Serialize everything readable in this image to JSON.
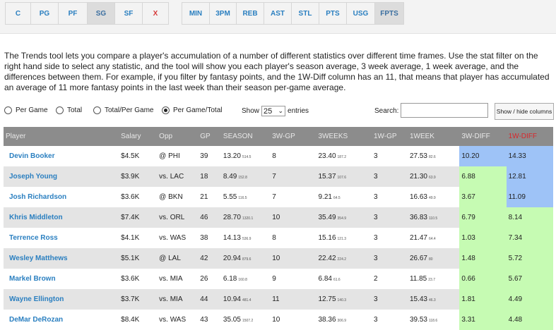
{
  "position_tabs": [
    {
      "label": "C",
      "active": false
    },
    {
      "label": "PG",
      "active": false
    },
    {
      "label": "PF",
      "active": false
    },
    {
      "label": "SG",
      "active": true
    },
    {
      "label": "SF",
      "active": false
    },
    {
      "label": "X",
      "active": false
    }
  ],
  "stat_tabs": [
    {
      "label": "MIN",
      "active": false
    },
    {
      "label": "3PM",
      "active": false
    },
    {
      "label": "REB",
      "active": false
    },
    {
      "label": "AST",
      "active": false
    },
    {
      "label": "STL",
      "active": false
    },
    {
      "label": "PTS",
      "active": false
    },
    {
      "label": "USG",
      "active": false
    },
    {
      "label": "FPTS",
      "active": true
    }
  ],
  "description": "The Trends tool lets you compare a player's accumulation of a number of different statistics over different time frames. Use the stat filter on the right hand side to select any statistic, and the tool will show you each player's season average, 3 week average, 1 week average, and the differences between them. For example, if you filter by fantasy points, and the 1W-Diff column has an 11, that means that player has accumulated an average of 11 more fantasy points in the last week than their season per-game average.",
  "radios": [
    {
      "label": "Per Game",
      "checked": false
    },
    {
      "label": "Total",
      "checked": false
    },
    {
      "label": "Total/Per Game",
      "checked": false
    },
    {
      "label": "Per Game/Total",
      "checked": true
    }
  ],
  "show": {
    "prefix": "Show",
    "value": "25",
    "suffix": "entries"
  },
  "search": {
    "label": "Search:",
    "value": ""
  },
  "toggle_button": "Show / hide columns",
  "colors": {
    "blue": "#9ec3f7",
    "green": "#c6fbb3",
    "header": "#8c8c8c"
  },
  "headers": [
    "Player",
    "Salary",
    "Opp",
    "GP",
    "SEASON",
    "3W-GP",
    "3WEEKS",
    "1W-GP",
    "1WEEK",
    "3W-DIFF",
    "1W-DIFF"
  ],
  "rows": [
    {
      "player": "Devin Booker",
      "salary": "$4.5K",
      "opp": "@ PHI",
      "gp": "39",
      "season": "13.20",
      "season_total": "514.5",
      "gp3": "8",
      "w3": "23.40",
      "w3_total": "187.2",
      "gp1": "3",
      "w1": "27.53",
      "w1_total": "82.6",
      "d3": "10.20",
      "d3_c": "blue",
      "d1": "14.33",
      "d1_c": "blue"
    },
    {
      "player": "Joseph Young",
      "salary": "$3.9K",
      "opp": "vs. LAC",
      "gp": "18",
      "season": "8.49",
      "season_total": "152.8",
      "gp3": "7",
      "w3": "15.37",
      "w3_total": "107.6",
      "gp1": "3",
      "w1": "21.30",
      "w1_total": "63.9",
      "d3": "6.88",
      "d3_c": "green",
      "d1": "12.81",
      "d1_c": "blue"
    },
    {
      "player": "Josh Richardson",
      "salary": "$3.6K",
      "opp": "@ BKN",
      "gp": "21",
      "season": "5.55",
      "season_total": "116.5",
      "gp3": "7",
      "w3": "9.21",
      "w3_total": "64.5",
      "gp1": "3",
      "w1": "16.63",
      "w1_total": "49.9",
      "d3": "3.67",
      "d3_c": "green",
      "d1": "11.09",
      "d1_c": "blue"
    },
    {
      "player": "Khris Middleton",
      "salary": "$7.4K",
      "opp": "vs. ORL",
      "gp": "46",
      "season": "28.70",
      "season_total": "1320.1",
      "gp3": "10",
      "w3": "35.49",
      "w3_total": "354.9",
      "gp1": "3",
      "w1": "36.83",
      "w1_total": "110.5",
      "d3": "6.79",
      "d3_c": "green",
      "d1": "8.14",
      "d1_c": "green"
    },
    {
      "player": "Terrence Ross",
      "salary": "$4.1K",
      "opp": "vs. WAS",
      "gp": "38",
      "season": "14.13",
      "season_total": "536.9",
      "gp3": "8",
      "w3": "15.16",
      "w3_total": "121.3",
      "gp1": "3",
      "w1": "21.47",
      "w1_total": "64.4",
      "d3": "1.03",
      "d3_c": "green",
      "d1": "7.34",
      "d1_c": "green"
    },
    {
      "player": "Wesley Matthews",
      "salary": "$5.1K",
      "opp": "@ LAL",
      "gp": "42",
      "season": "20.94",
      "season_total": "879.6",
      "gp3": "10",
      "w3": "22.42",
      "w3_total": "224.2",
      "gp1": "3",
      "w1": "26.67",
      "w1_total": "80",
      "d3": "1.48",
      "d3_c": "green",
      "d1": "5.72",
      "d1_c": "green"
    },
    {
      "player": "Markel Brown",
      "salary": "$3.6K",
      "opp": "vs. MIA",
      "gp": "26",
      "season": "6.18",
      "season_total": "160.8",
      "gp3": "9",
      "w3": "6.84",
      "w3_total": "61.6",
      "gp1": "2",
      "w1": "11.85",
      "w1_total": "23.7",
      "d3": "0.66",
      "d3_c": "green",
      "d1": "5.67",
      "d1_c": "green"
    },
    {
      "player": "Wayne Ellington",
      "salary": "$3.7K",
      "opp": "vs. MIA",
      "gp": "44",
      "season": "10.94",
      "season_total": "481.4",
      "gp3": "11",
      "w3": "12.75",
      "w3_total": "140.3",
      "gp1": "3",
      "w1": "15.43",
      "w1_total": "46.3",
      "d3": "1.81",
      "d3_c": "green",
      "d1": "4.49",
      "d1_c": "green"
    },
    {
      "player": "DeMar DeRozan",
      "salary": "$8.4K",
      "opp": "vs. WAS",
      "gp": "43",
      "season": "35.05",
      "season_total": "1507.2",
      "gp3": "10",
      "w3": "38.36",
      "w3_total": "306.9",
      "gp1": "3",
      "w1": "39.53",
      "w1_total": "118.6",
      "d3": "3.31",
      "d3_c": "green",
      "d1": "4.48",
      "d1_c": "green"
    }
  ]
}
